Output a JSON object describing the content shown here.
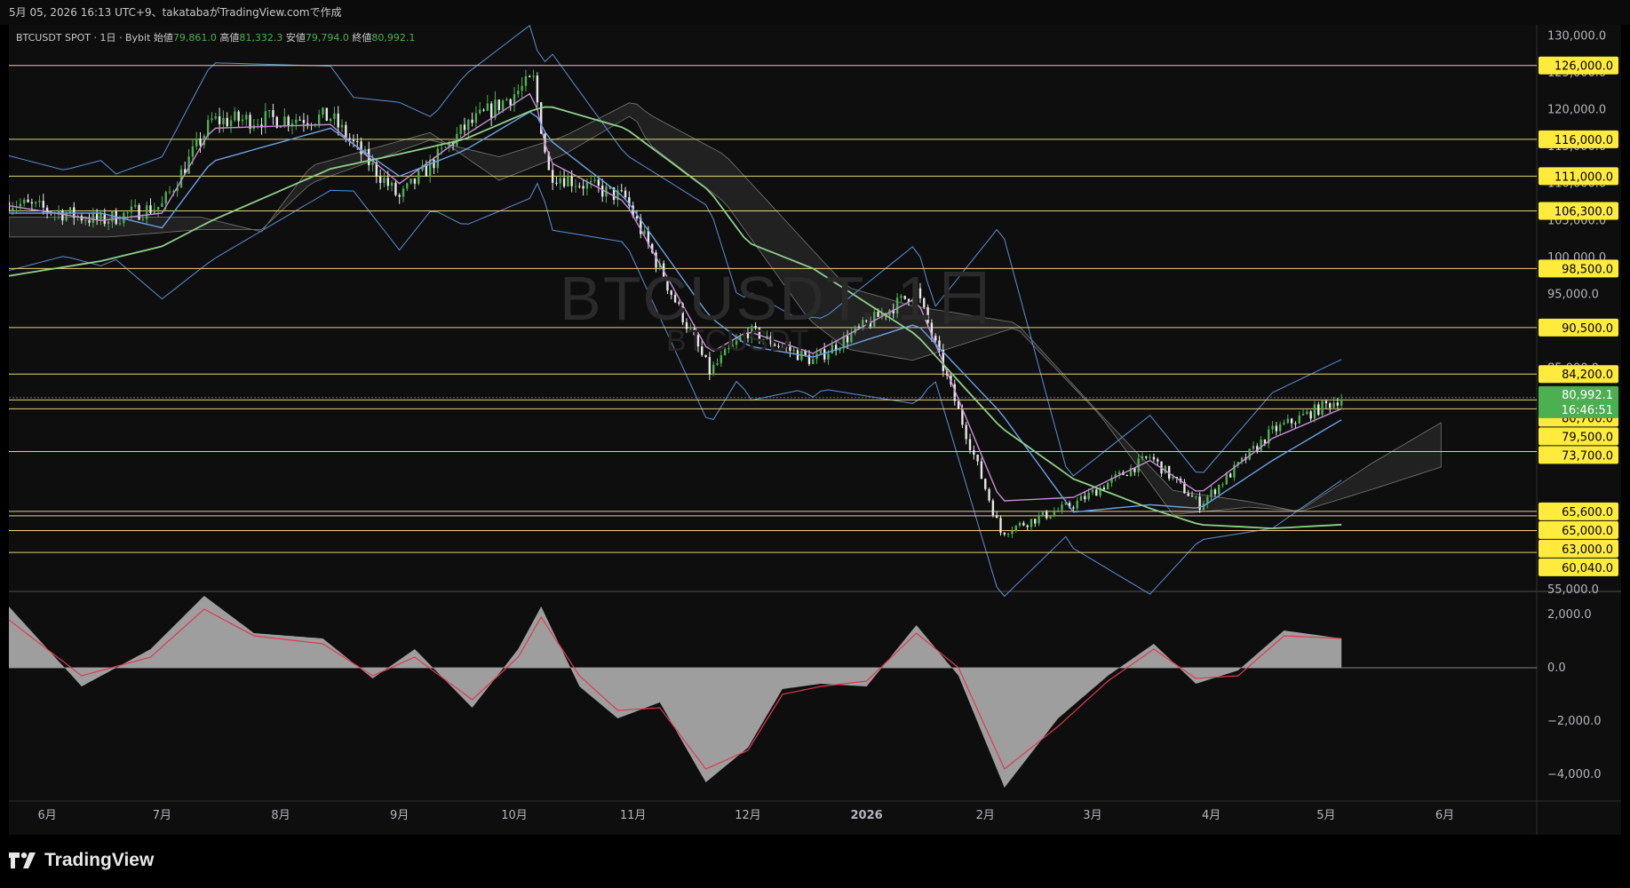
{
  "header": {
    "caption": "5月 05, 2026 16:13 UTC+9、takatabaがTradingView.comで作成"
  },
  "legend": {
    "symbol": "BTCUSDT SPOT · 1日 · Bybit",
    "open_label": "始値",
    "open": "79,861.0",
    "high_label": "高値",
    "high": "81,332.3",
    "low_label": "安値",
    "low": "79,794.0",
    "close_label": "終値",
    "close": "80,992.1"
  },
  "watermark": {
    "main": "BTCUSDT, 1日",
    "sub": "BTCUSDT"
  },
  "branding": {
    "logo_text": "TradingView"
  },
  "colors": {
    "up": "#4caf50",
    "down": "#e8e8e8",
    "bollinger": "#5b8fd6",
    "ma_short": "#c98cd6",
    "ma_mid": "#6aa2e6",
    "ma_long": "#8fd08a",
    "level_line": "#e6d27a",
    "level_label_bg": "#ffeb3b",
    "price_label_bg": "#4caf50",
    "histogram": "#9e9e9e",
    "signal": "#e0394e"
  },
  "chart_data": [
    {
      "type": "line",
      "title": "BTCUSDT, 1日",
      "description": "Daily candlestick price chart with moving averages, Bollinger bands, Ichimoku cloud and horizontal levels",
      "y_axis_ticks": [
        "130,000.0",
        "125,000.0",
        "120,000.0",
        "115,000.0",
        "110,000.0",
        "105,000.0",
        "100,000.0",
        "95,000.0",
        "90,000.0",
        "85,000.0",
        "55,000.0"
      ],
      "ylim": [
        55000,
        131500
      ],
      "x_axis_ticks": [
        "6月",
        "7月",
        "8月",
        "9月",
        "10月",
        "11月",
        "12月",
        "2026",
        "2月",
        "3月",
        "4月",
        "5月",
        "6月"
      ],
      "x_range": [
        "2025-05-22",
        "2026-06-25"
      ],
      "horizontal_levels": [
        "126,000.0",
        "116,000.0",
        "111,000.0",
        "106,300.0",
        "98,500.0",
        "90,500.0",
        "84,200.0",
        "80,700.0",
        "79,500.0",
        "73,700.0",
        "65,600.0",
        "65,000.0",
        "63,000.0",
        "60,040.0"
      ],
      "current_price": "80,992.1",
      "countdown": "16:46:51",
      "series": [
        {
          "name": "Close",
          "x": [
            "2025-05-22",
            "2025-06-15",
            "2025-07-01",
            "2025-07-14",
            "2025-08-14",
            "2025-09-01",
            "2025-09-18",
            "2025-10-06",
            "2025-10-10",
            "2025-10-30",
            "2025-11-21",
            "2025-12-01",
            "2025-12-18",
            "2026-01-14",
            "2026-02-05",
            "2026-02-24",
            "2026-03-16",
            "2026-03-29",
            "2026-04-17",
            "2026-05-05"
          ],
          "values": [
            107500,
            105000,
            107000,
            118500,
            119000,
            108000,
            117500,
            124000,
            111500,
            108000,
            84500,
            90000,
            86000,
            95500,
            62800,
            66500,
            73000,
            66500,
            76500,
            80992
          ]
        },
        {
          "name": "MA short",
          "values": [
            107000,
            105000,
            106000,
            117500,
            118000,
            110000,
            116500,
            122500,
            113000,
            107500,
            87000,
            90000,
            87000,
            94500,
            67000,
            67500,
            72500,
            68000,
            75500,
            79500
          ]
        },
        {
          "name": "MA mid",
          "values": [
            106000,
            106000,
            104000,
            113000,
            117500,
            111000,
            114500,
            120000,
            116000,
            108000,
            92000,
            88000,
            86500,
            91000,
            79000,
            65500,
            66500,
            66000,
            72500,
            78000
          ]
        },
        {
          "name": "MA long",
          "values": [
            97500,
            99500,
            101500,
            105000,
            112000,
            114000,
            116000,
            120000,
            120500,
            117500,
            109000,
            102000,
            98500,
            89500,
            77000,
            70000,
            66000,
            63800,
            63300,
            63800
          ]
        }
      ]
    },
    {
      "type": "area",
      "title": "",
      "description": "MACD style oscillator histogram with signal line",
      "y_axis_ticks": [
        "2,000.0",
        "0.0",
        "−2,000.0",
        "−4,000.0"
      ],
      "ylim": [
        -5000,
        2800
      ],
      "series": [
        {
          "name": "Histogram",
          "x": [
            "2025-05-22",
            "2025-06-10",
            "2025-06-28",
            "2025-07-12",
            "2025-07-25",
            "2025-08-12",
            "2025-08-25",
            "2025-09-05",
            "2025-09-20",
            "2025-10-02",
            "2025-10-08",
            "2025-10-18",
            "2025-10-28",
            "2025-11-08",
            "2025-11-20",
            "2025-12-01",
            "2025-12-10",
            "2025-12-20",
            "2026-01-01",
            "2026-01-14",
            "2026-01-25",
            "2026-02-06",
            "2026-02-20",
            "2026-03-05",
            "2026-03-17",
            "2026-03-28",
            "2026-04-08",
            "2026-04-20",
            "2026-05-05"
          ],
          "values": [
            2300,
            -700,
            700,
            2700,
            1300,
            1100,
            -400,
            700,
            -1500,
            700,
            2300,
            -700,
            -1900,
            -1300,
            -4300,
            -3000,
            -800,
            -600,
            -700,
            1600,
            -300,
            -4500,
            -1900,
            -300,
            900,
            -600,
            -100,
            1400,
            1100
          ]
        },
        {
          "name": "Signal",
          "values": [
            1800,
            -300,
            400,
            2200,
            1200,
            900,
            -300,
            400,
            -1200,
            400,
            1900,
            -300,
            -1600,
            -1500,
            -3800,
            -3100,
            -1000,
            -700,
            -500,
            1300,
            0,
            -3800,
            -2200,
            -500,
            700,
            -400,
            -300,
            1200,
            1100
          ]
        }
      ]
    }
  ]
}
